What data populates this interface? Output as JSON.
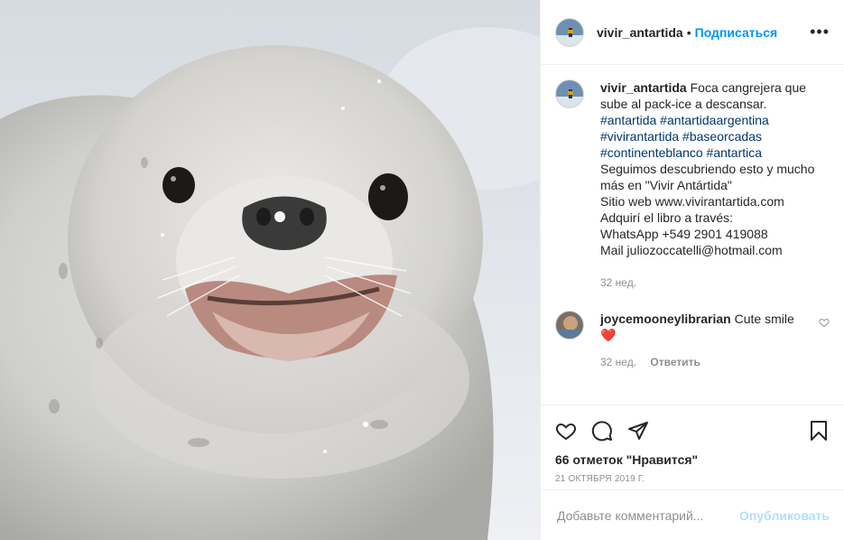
{
  "post": {
    "username": "vivir_antartida",
    "dot": "•",
    "follow_label": "Подписаться",
    "more_label": "•••"
  },
  "caption": {
    "username": "vivir_antartida",
    "text_first": "Foca cangrejera que sube al pack-ice a descansar.",
    "hashtags": [
      "#antartida",
      "#antartidaargentina",
      "#vivirantartida",
      "#baseorcadas",
      "#continenteblanco",
      "#antartica"
    ],
    "lines": [
      "Seguimos descubriendo esto y mucho más en \"Vivir Antártida\"",
      "Sitio web www.vivirantartida.com",
      "Adquirí el libro a través:",
      "WhatsApp +549 2901 419088",
      "Mail juliozoccatelli@hotmail.com"
    ],
    "time": "32 нед."
  },
  "comment": {
    "username": "joycemooneylibrarian",
    "text": "Cute smile",
    "emoji": "❤️",
    "time": "32 нед.",
    "reply_label": "Ответить"
  },
  "actions": {
    "icons": [
      "heart-icon",
      "comment-icon",
      "share-icon",
      "bookmark-icon"
    ],
    "likes": "66 отметок \"Нравится\"",
    "date": "21 ОКТЯБРЯ 2019 Г."
  },
  "add_comment": {
    "placeholder": "Добавьте комментарий...",
    "post_label": "Опубликовать"
  },
  "colors": {
    "link": "#0095f6",
    "hashtag": "#00376b",
    "muted": "#8e8e8e",
    "post_disabled": "#b2dffc"
  }
}
